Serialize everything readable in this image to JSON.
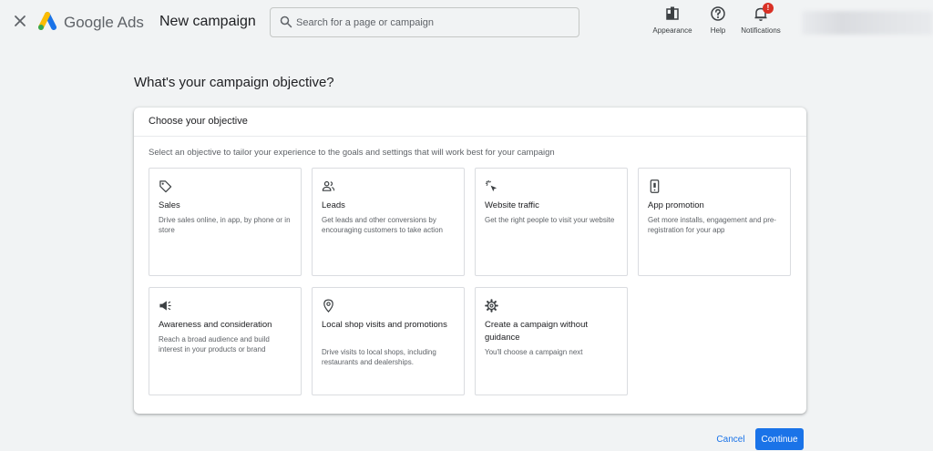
{
  "header": {
    "brand_google": "Google",
    "brand_ads": "Ads",
    "page_title": "New campaign",
    "search_placeholder": "Search for a page or campaign",
    "tools": [
      {
        "label": "Appearance",
        "icon": "appearance-icon"
      },
      {
        "label": "Help",
        "icon": "help-icon"
      },
      {
        "label": "Notifications",
        "icon": "bell-icon",
        "badge": "!"
      }
    ]
  },
  "main": {
    "question": "What's your campaign objective?",
    "panel_title": "Choose your objective",
    "panel_description": "Select an objective to tailor your experience to the goals and settings that will work best for your campaign",
    "objectives": [
      {
        "title": "Sales",
        "description": "Drive sales online, in app, by phone or in store",
        "icon": "tag-icon"
      },
      {
        "title": "Leads",
        "description": "Get leads and other conversions by encouraging customers to take action",
        "icon": "people-icon"
      },
      {
        "title": "Website traffic",
        "description": "Get the right people to visit your website",
        "icon": "cursor-click-icon"
      },
      {
        "title": "App promotion",
        "description": "Get more installs, engagement and pre-registration for your app",
        "icon": "phone-icon"
      },
      {
        "title": "Awareness and consideration",
        "description": "Reach a broad audience and build interest in your products or brand",
        "icon": "megaphone-icon"
      },
      {
        "title": "Local shop visits and promotions",
        "description": "Drive visits to local shops, including restaurants and dealerships.",
        "icon": "location-pin-icon"
      },
      {
        "title": "Create a campaign without guidance",
        "description": "You'll choose a campaign next",
        "icon": "gear-icon"
      }
    ]
  },
  "footer": {
    "cancel_label": "Cancel",
    "continue_label": "Continue"
  },
  "colors": {
    "accent": "#1a73e8",
    "badge": "#d93025",
    "background": "#f1f3f4"
  }
}
